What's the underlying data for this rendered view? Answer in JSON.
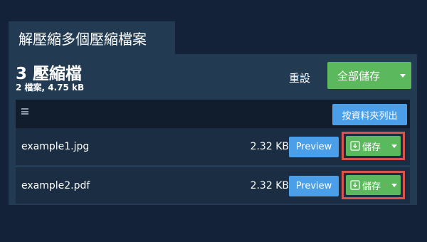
{
  "tab": {
    "title": "解壓縮多個壓縮檔案"
  },
  "summary": {
    "title": "3 壓縮檔",
    "subtitle": "2 檔案, 4.75 kB"
  },
  "toolbar": {
    "reset_label": "重設",
    "save_all_label": "全部儲存"
  },
  "list_header": {
    "list_by_folder_label": "按資料夾列出"
  },
  "files": [
    {
      "name": "example1.jpg",
      "size": "2.32 KB",
      "preview_label": "Preview",
      "save_label": "儲存"
    },
    {
      "name": "example2.pdf",
      "size": "2.32 KB",
      "preview_label": "Preview",
      "save_label": "儲存"
    }
  ],
  "colors": {
    "background": "#132238",
    "panel": "#223a52",
    "primary_green": "#5cb85c",
    "primary_blue": "#4a9fe8",
    "highlight_red": "#d9534f"
  },
  "icons": {
    "menu": "menu-lines-icon",
    "caret": "caret-down-icon",
    "download": "download-icon"
  }
}
